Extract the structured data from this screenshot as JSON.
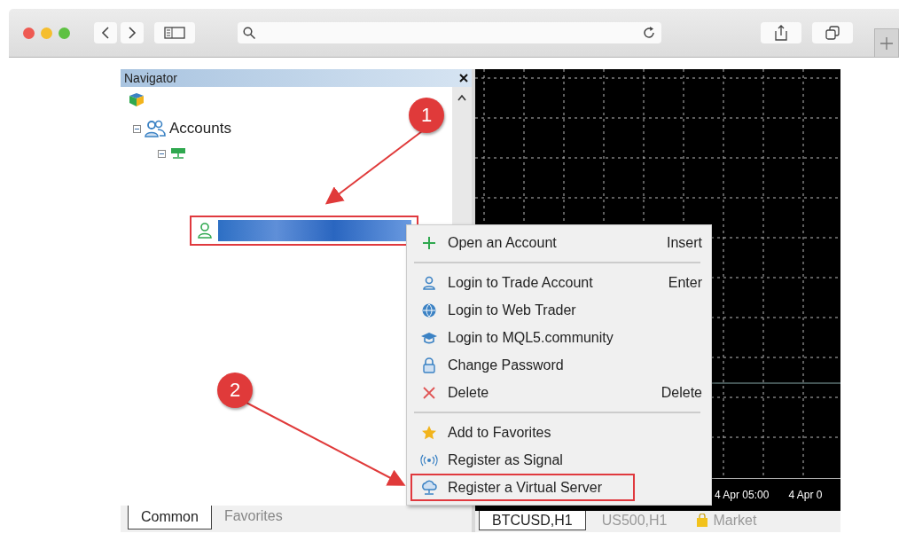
{
  "navigator": {
    "title": "Navigator",
    "tree": [
      {
        "label": "Accounts",
        "expanded": true,
        "children": [
          {
            "kind": "server",
            "expanded": true,
            "children": [
              {
                "kind": "account",
                "selected": true,
                "marked": true
              }
            ]
          }
        ]
      }
    ],
    "tabs": [
      {
        "label": "Common",
        "selected": true
      },
      {
        "label": "Favorites",
        "selected": false
      }
    ]
  },
  "context_menu": {
    "items": [
      {
        "kind": "item",
        "label": "Open an Account",
        "shortcut": "Insert",
        "marked": false
      },
      {
        "kind": "separator"
      },
      {
        "kind": "item",
        "label": "Login to Trade Account",
        "shortcut": "Enter",
        "marked": false
      },
      {
        "kind": "item",
        "label": "Login to Web Trader",
        "marked": false
      },
      {
        "kind": "item",
        "label": "Login to MQL5.community",
        "marked": false
      },
      {
        "kind": "item",
        "label": "Change Password",
        "marked": false
      },
      {
        "kind": "item",
        "label": "Delete",
        "shortcut": "Delete",
        "marked": false
      },
      {
        "kind": "separator"
      },
      {
        "kind": "item",
        "label": "Add to Favorites",
        "marked": false
      },
      {
        "kind": "item",
        "label": "Register as Signal",
        "marked": false
      },
      {
        "kind": "item",
        "label": "Register a Virtual Server",
        "marked": true
      }
    ]
  },
  "chart": {
    "time_labels": [
      "4 Apr 05:00",
      "4 Apr 0"
    ],
    "tabs": [
      {
        "label": "BTCUSD,H1",
        "selected": true
      },
      {
        "label": "US500,H1",
        "selected": false
      },
      {
        "label": "Market",
        "selected": false
      }
    ]
  },
  "annotations": [
    {
      "label": "1"
    },
    {
      "label": "2"
    }
  ]
}
